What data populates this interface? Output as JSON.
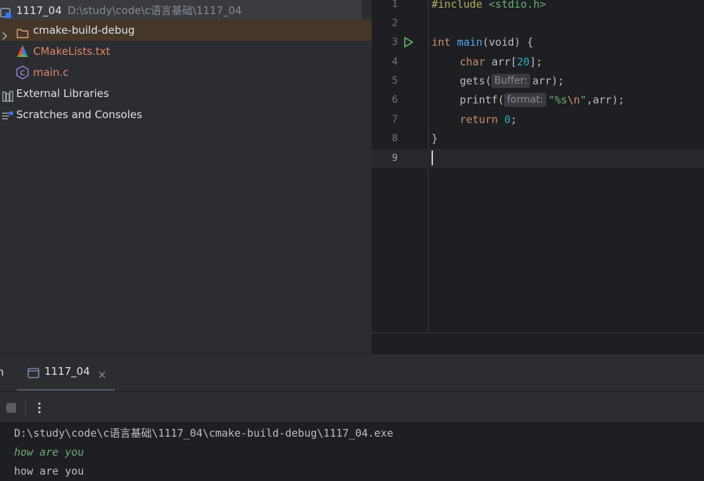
{
  "project_tree": {
    "root_name": "1117_04",
    "root_path": "D:\\study\\code\\c语言基础\\1117_04",
    "items": [
      {
        "label": "cmake-build-debug"
      },
      {
        "label": "CMakeLists.txt"
      },
      {
        "label": "main.c"
      },
      {
        "label": "External Libraries"
      },
      {
        "label": "Scratches and Consoles"
      }
    ]
  },
  "editor": {
    "lines": [
      {
        "num": "1",
        "include": "#include",
        "header": "<stdio.h>"
      },
      {
        "num": "2"
      },
      {
        "num": "3",
        "kw": "int",
        "fn": "main",
        "rest": "(void) {"
      },
      {
        "num": "4",
        "kw": "char",
        "rest_a": " arr[",
        "num_val": "20",
        "rest_b": "];"
      },
      {
        "num": "5",
        "call": "gets(",
        "hint": "Buffer:",
        "rest": "arr);"
      },
      {
        "num": "6",
        "call": "printf(",
        "hint": "format:",
        "str_a": "\"%s",
        "esc": "\\n",
        "str_b": "\"",
        "rest": ",arr);"
      },
      {
        "num": "7",
        "kw": "return",
        "num_val": "0",
        "rest": ";"
      },
      {
        "num": "8",
        "rest": "}"
      },
      {
        "num": "9"
      }
    ]
  },
  "run_window": {
    "tab_label": "1117_04",
    "console": [
      "D:\\study\\code\\c语言基础\\1117_04\\cmake-build-debug\\1117_04.exe",
      "how are you",
      "how are you"
    ]
  },
  "colors": {
    "keyword": "#cf8e6d",
    "function": "#56a8f5",
    "number": "#2aacb8",
    "string": "#6aab73",
    "preprocessor": "#b3ae60"
  }
}
